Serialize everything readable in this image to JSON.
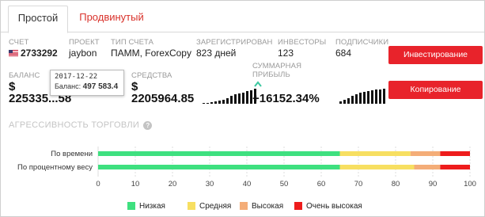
{
  "tabs": [
    {
      "label": "Простой",
      "active": true
    },
    {
      "label": "Продвинутый",
      "active": false
    }
  ],
  "info": {
    "account": {
      "label": "СЧЕТ",
      "value": "2733292"
    },
    "project": {
      "label": "ПРОЕКТ",
      "value": "jaybon"
    },
    "account_type": {
      "label": "ТИП СЧЕТА",
      "value": "ПАММ, ForexCopy"
    },
    "registered": {
      "label": "ЗАРЕГИСТРИРОВАН",
      "value": "823 дней"
    },
    "investors": {
      "label": "ИНВЕСТОРЫ",
      "value": "123"
    },
    "subscribers": {
      "label": "ПОДПИСЧИКИ",
      "value": "684"
    }
  },
  "metrics": {
    "balance": {
      "label": "БАЛАНС",
      "currency": "$",
      "value": "225335...58"
    },
    "funds": {
      "label": "СРЕДСТВА",
      "currency": "$",
      "value": "2205964.85"
    },
    "profit": {
      "label_line1": "СУММАРНАЯ",
      "label_line2": "ПРИБЫЛЬ",
      "value": "+16152.34%"
    }
  },
  "sparklines": {
    "balance": [
      1,
      1,
      2,
      3,
      4,
      5,
      7,
      9,
      11,
      12,
      13,
      15,
      16,
      18
    ],
    "funds": [
      1,
      1,
      2,
      3,
      4,
      5,
      7,
      9,
      11,
      12,
      13,
      15,
      16,
      18
    ],
    "profit": [
      3,
      5,
      7,
      9,
      11,
      13,
      14,
      15,
      16,
      17,
      17,
      18
    ]
  },
  "tooltip": {
    "date": "2017-12-22",
    "label": "Баланс:",
    "value": "497 583.4"
  },
  "buttons": {
    "invest": "Инвестирование",
    "copy": "Копирование"
  },
  "aggression": {
    "title": "АГРЕССИВНОСТЬ ТОРГОВЛИ",
    "help_icon": "question-icon"
  },
  "chart_data": {
    "type": "bar",
    "orientation": "horizontal",
    "stacked": true,
    "categories": [
      "По времени",
      "По процентному весу"
    ],
    "series": [
      {
        "name": "Низкая",
        "color": "#3ee07f",
        "values": [
          65,
          65
        ]
      },
      {
        "name": "Средняя",
        "color": "#f7df61",
        "values": [
          19,
          20
        ]
      },
      {
        "name": "Высокая",
        "color": "#f4ad78",
        "values": [
          8,
          7
        ]
      },
      {
        "name": "Очень высокая",
        "color": "#ee1c1c",
        "values": [
          8,
          8
        ]
      }
    ],
    "xlim": [
      0,
      100
    ],
    "xticks": [
      0,
      10,
      20,
      30,
      40,
      50,
      60,
      70,
      80,
      90,
      100
    ],
    "grid": true,
    "legend": "bottom"
  },
  "colors": {
    "accent": "#e8232b",
    "tab_inactive": "#d9322b",
    "profit_up": "#3cc8a0"
  }
}
